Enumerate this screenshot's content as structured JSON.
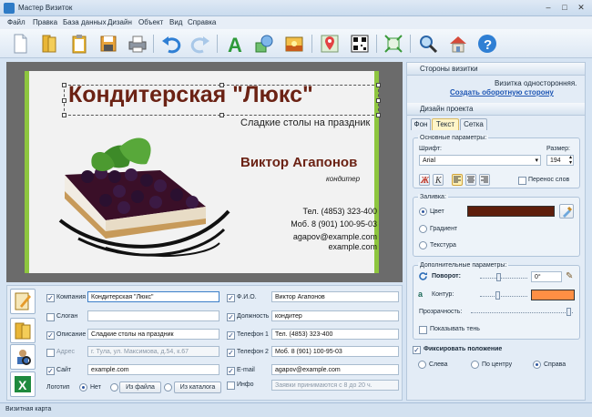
{
  "window": {
    "title": "Мастер Визиток"
  },
  "menu": [
    "Файл",
    "Правка",
    "База данных",
    "Дизайн",
    "Объект",
    "Вид",
    "Справка"
  ],
  "toolbar": {
    "icons": [
      "new-file-icon",
      "open-folder-icon",
      "clipboard-icon",
      "save-icon",
      "print-icon",
      "undo-icon",
      "redo-icon",
      "text-tool-icon",
      "shapes-tool-icon",
      "image-tool-icon",
      "map-icon",
      "qr-code-icon",
      "fit-icon",
      "zoom-icon",
      "home-icon",
      "help-icon"
    ]
  },
  "card": {
    "company": "Кондитерская \"Люкс\"",
    "slogan": "Сладкие столы на праздник",
    "name": "Виктор Агапонов",
    "position": "кондитер",
    "phone1": "Тел. (4853) 323-400",
    "phone2": "Моб. 8 (901) 100-95-03",
    "email": "agapov@example.com",
    "site": "example.com",
    "accent_color": "#6b2214",
    "stripe_color": "#8ec63f"
  },
  "fields": {
    "company_label": "Компания",
    "company_value": "Кондитерская \"Люкс\"",
    "slogan_label": "Слоган",
    "slogan_value": "",
    "desc_label": "Описание",
    "desc_value": "Сладкие столы на праздник",
    "address_label": "Адрес",
    "address_value": "г. Тула, ул. Максимова, д.54, к.67",
    "site_label": "Сайт",
    "site_value": "example.com",
    "logo_label": "Логотип",
    "logo_none": "Нет",
    "logo_file": "Из файла",
    "logo_catalog": "Из каталога",
    "fio_label": "Ф.И.О.",
    "fio_value": "Виктор Агапонов",
    "position_label": "Должность",
    "position_value": "кондитер",
    "phone1_label": "Телефон 1",
    "phone1_value": "Тел. (4853) 323-400",
    "phone2_label": "Телефон 2",
    "phone2_value": "Моб. 8 (901) 100-95-03",
    "email_label": "E-mail",
    "email_value": "agapov@example.com",
    "info_label": "Инфо",
    "info_value": "Заявки принимаются с 8 до 20 ч."
  },
  "panel": {
    "sides_header": "Стороны визитки",
    "sides_info": "Визитка односторонняя.",
    "sides_link": "Создать оборотную сторону",
    "design_header": "Дизайн проекта",
    "tabs": [
      "Фон",
      "Текст",
      "Сетка"
    ],
    "basic_title": "Основные параметры:",
    "font_label": "Шрифт:",
    "font_value": "Arial",
    "size_label": "Размер:",
    "size_value": "194",
    "wrap_label": "Перенос слов",
    "fill_title": "Заливка:",
    "fill_color": "Цвет",
    "fill_gradient": "Градиент",
    "fill_texture": "Текстура",
    "fill_swatch": "#5e1e0c",
    "extra_title": "Дополнительные параметры:",
    "rotate_label": "Поворот:",
    "rotate_value": "0°",
    "outline_label": "Контур:",
    "outline_swatch": "#ff8f44",
    "opacity_label": "Прозрачность:",
    "shadow_label": "Показывать тень",
    "fix_label": "Фиксировать положение",
    "pos_left": "Слева",
    "pos_center": "По центру",
    "pos_right": "Справа"
  },
  "status": "Визитная карта"
}
